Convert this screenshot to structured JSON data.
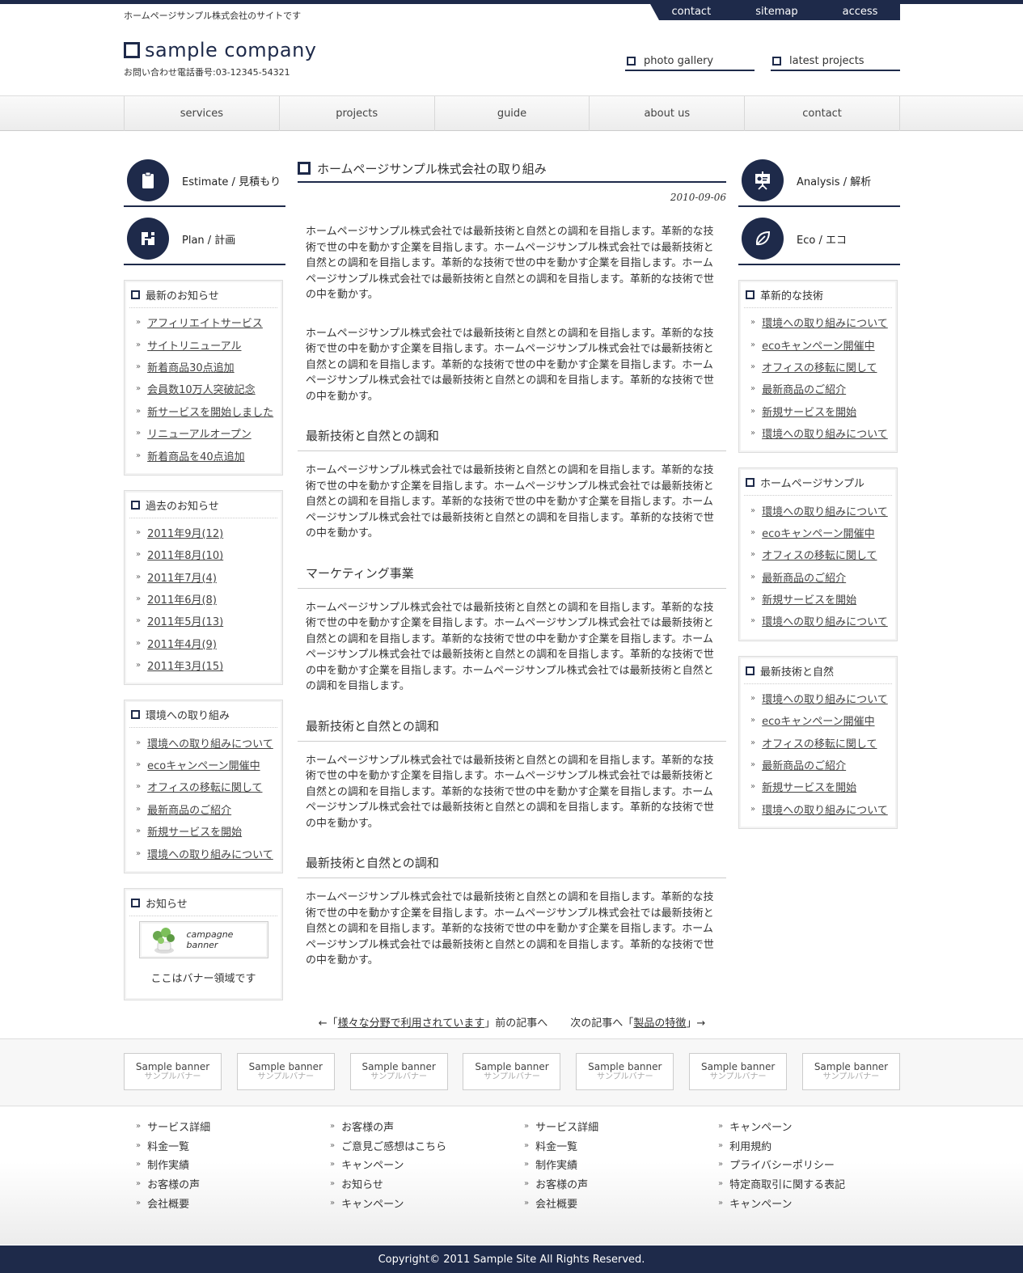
{
  "header": {
    "tagline": "ホームページサンプル株式会社のサイトです",
    "toplinks": [
      "contact",
      "sitemap",
      "access"
    ],
    "logo": "sample company",
    "phone": "お問い合わせ電話番号:03-12345-54321",
    "links": [
      "photo gallery",
      "latest projects"
    ]
  },
  "nav": [
    "services",
    "projects",
    "guide",
    "about us",
    "contact"
  ],
  "left": {
    "buttons": [
      "Estimate / 見積もり",
      "Plan / 計画"
    ],
    "boxes": [
      {
        "title": "最新のお知らせ",
        "items": [
          "アフィリエイトサービス",
          "サイトリニューアル",
          "新着商品30点追加",
          "会員数10万人突破記念",
          "新サービスを開始しました",
          "リニューアルオープン",
          "新着商品を40点追加"
        ]
      },
      {
        "title": "過去のお知らせ",
        "items": [
          "2011年9月(12)",
          "2011年8月(10)",
          "2011年7月(4)",
          "2011年6月(8)",
          "2011年5月(13)",
          "2011年4月(9)",
          "2011年3月(15)"
        ]
      },
      {
        "title": "環境への取り組み",
        "items": [
          "環境への取り組みについて",
          "ecoキャンペーン開催中",
          "オフィスの移転に関して",
          "最新商品のご紹介",
          "新規サービスを開始",
          "環境への取り組みについて"
        ]
      }
    ],
    "notice": {
      "title": "お知らせ",
      "banner": "campagne banner",
      "caption": "ここはバナー領域です"
    }
  },
  "right": {
    "buttons": [
      "Analysis / 解析",
      "Eco / エコ"
    ],
    "boxes": [
      {
        "title": "革新的な技術",
        "items": [
          "環境への取り組みについて",
          "ecoキャンペーン開催中",
          "オフィスの移転に関して",
          "最新商品のご紹介",
          "新規サービスを開始",
          "環境への取り組みについて"
        ]
      },
      {
        "title": "ホームページサンプル",
        "items": [
          "環境への取り組みについて",
          "ecoキャンペーン開催中",
          "オフィスの移転に関して",
          "最新商品のご紹介",
          "新規サービスを開始",
          "環境への取り組みについて"
        ]
      },
      {
        "title": "最新技術と自然",
        "items": [
          "環境への取り組みについて",
          "ecoキャンペーン開催中",
          "オフィスの移転に関して",
          "最新商品のご紹介",
          "新規サービスを開始",
          "環境への取り組みについて"
        ]
      }
    ]
  },
  "main": {
    "title": "ホームページサンプル株式会社の取り組み",
    "date": "2010-09-06",
    "p1": "ホームページサンプル株式会社では最新技術と自然との調和を目指します。革新的な技術で世の中を動かす企業を目指します。ホームページサンプル株式会社では最新技術と自然との調和を目指します。革新的な技術で世の中を動かす企業を目指します。ホームページサンプル株式会社では最新技術と自然との調和を目指します。革新的な技術で世の中を動かす。",
    "p2": "ホームページサンプル株式会社では最新技術と自然との調和を目指します。革新的な技術で世の中を動かす企業を目指します。ホームページサンプル株式会社では最新技術と自然との調和を目指します。革新的な技術で世の中を動かす企業を目指します。ホームページサンプル株式会社では最新技術と自然との調和を目指します。革新的な技術で世の中を動かす。",
    "sections": [
      {
        "heading": "最新技術と自然との調和",
        "text": "ホームページサンプル株式会社では最新技術と自然との調和を目指します。革新的な技術で世の中を動かす企業を目指します。ホームページサンプル株式会社では最新技術と自然との調和を目指します。革新的な技術で世の中を動かす企業を目指します。ホームページサンプル株式会社では最新技術と自然との調和を目指します。革新的な技術で世の中を動かす。"
      },
      {
        "heading": "マーケティング事業",
        "text": "ホームページサンプル株式会社では最新技術と自然との調和を目指します。革新的な技術で世の中を動かす企業を目指します。ホームページサンプル株式会社では最新技術と自然との調和を目指します。革新的な技術で世の中を動かす企業を目指します。ホームページサンプル株式会社では最新技術と自然との調和を目指します。革新的な技術で世の中を動かす企業を目指します。ホームページサンプル株式会社では最新技術と自然との調和を目指します。"
      },
      {
        "heading": "最新技術と自然との調和",
        "text": "ホームページサンプル株式会社では最新技術と自然との調和を目指します。革新的な技術で世の中を動かす企業を目指します。ホームページサンプル株式会社では最新技術と自然との調和を目指します。革新的な技術で世の中を動かす企業を目指します。ホームページサンプル株式会社では最新技術と自然との調和を目指します。革新的な技術で世の中を動かす。"
      },
      {
        "heading": "最新技術と自然との調和",
        "text": "ホームページサンプル株式会社では最新技術と自然との調和を目指します。革新的な技術で世の中を動かす企業を目指します。ホームページサンプル株式会社では最新技術と自然との調和を目指します。革新的な技術で世の中を動かす企業を目指します。ホームページサンプル株式会社では最新技術と自然との調和を目指します。革新的な技術で世の中を動かす。"
      }
    ],
    "pager": {
      "prev_pre": "←「",
      "prev_link": "様々な分野で利用されています",
      "prev_post": "」前の記事へ",
      "next_pre": "次の記事へ「",
      "next_link": "製品の特徴",
      "next_post": "」→"
    }
  },
  "banners": {
    "title": "Sample banner",
    "sub": "サンプルバナー",
    "count_labels": [
      "1",
      "2",
      "3",
      "4",
      "5",
      "6",
      "7"
    ]
  },
  "footer": {
    "cols": [
      [
        "サービス詳細",
        "料金一覧",
        "制作実績",
        "お客様の声",
        "会社概要"
      ],
      [
        "お客様の声",
        "ご意見ご感想はこちら",
        "キャンペーン",
        "お知らせ",
        "キャンペーン"
      ],
      [
        "サービス詳細",
        "料金一覧",
        "制作実績",
        "お客様の声",
        "会社概要"
      ],
      [
        "キャンペーン",
        "利用規約",
        "プライバシーポリシー",
        "特定商取引に関する表記",
        "キャンペーン"
      ]
    ],
    "copyright": "Copyright© 2011 Sample Site All Rights Reserved."
  },
  "colors": {
    "accent": "#1e2a4a"
  }
}
